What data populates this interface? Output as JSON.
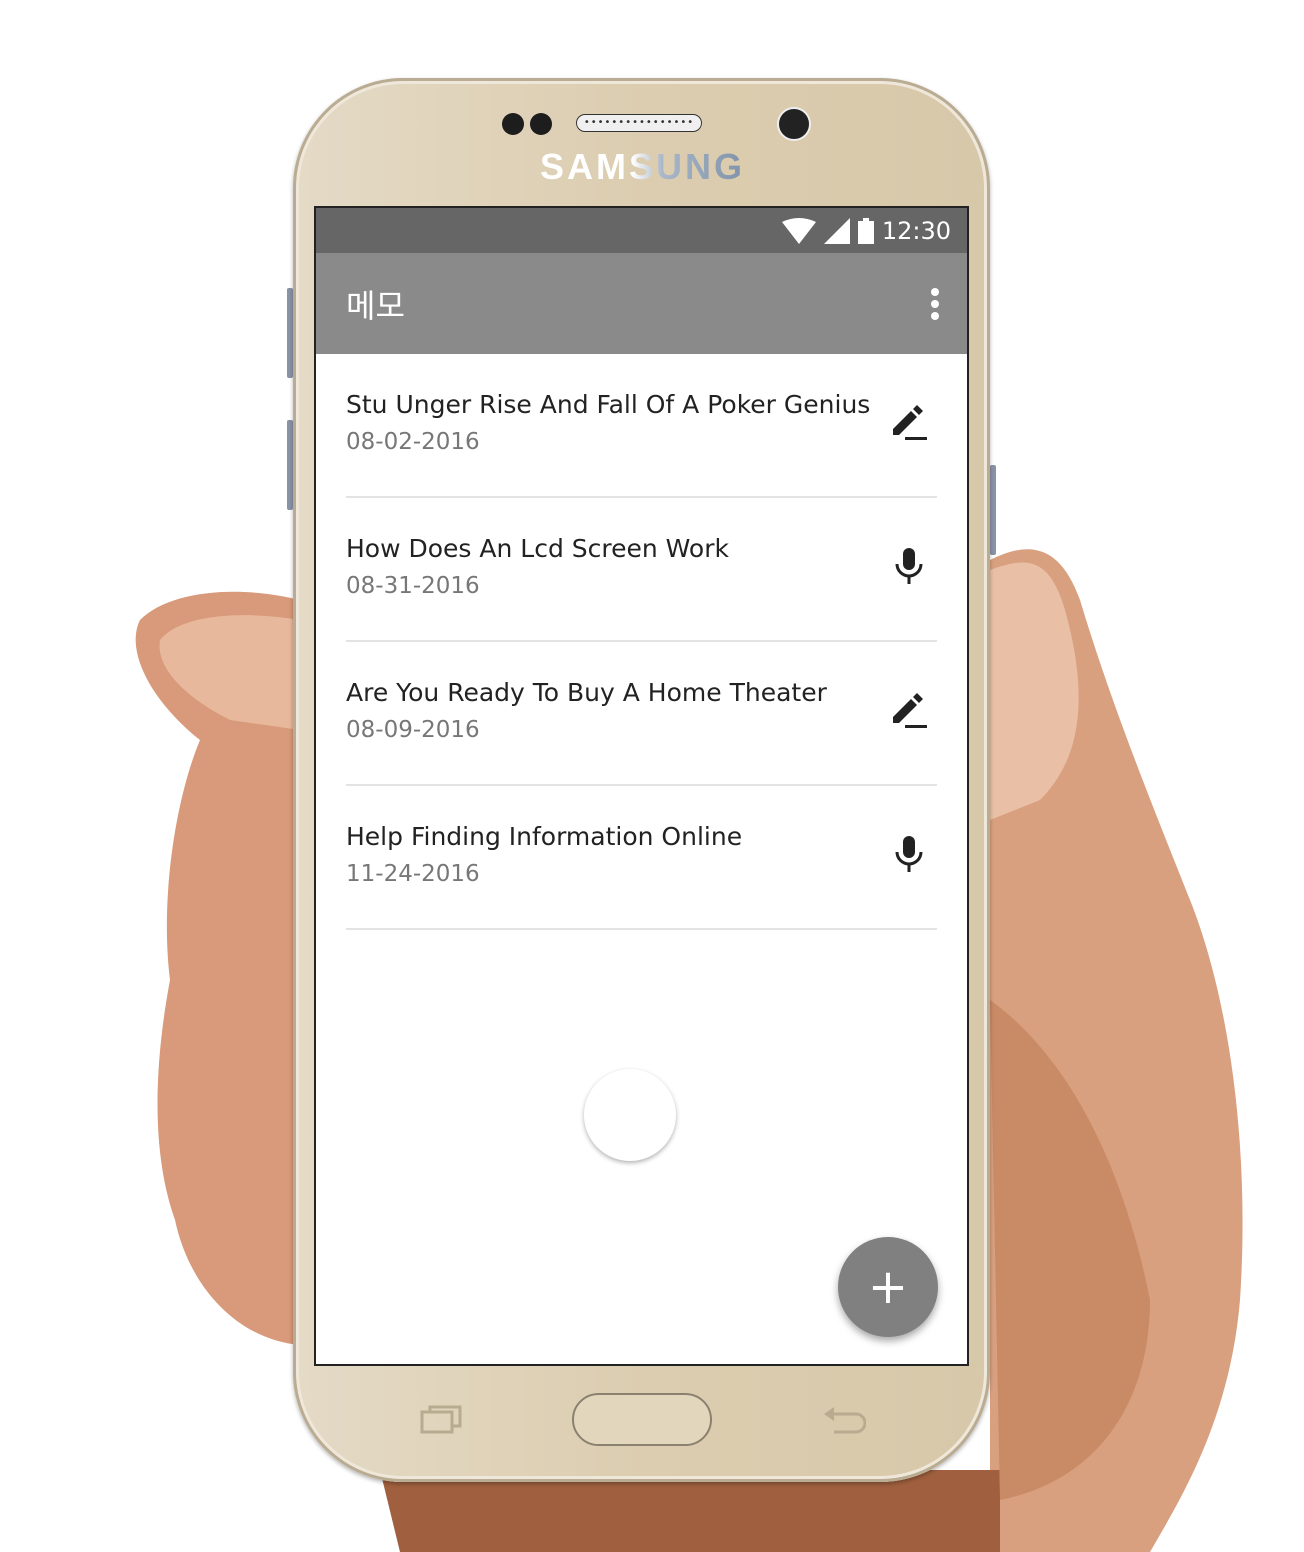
{
  "device": {
    "brand": "SAMSUNG",
    "speaker_grille": "••••••••••••••••"
  },
  "status_bar": {
    "time": "12:30",
    "icons": [
      "wifi-icon",
      "signal-icon",
      "battery-icon"
    ]
  },
  "app_bar": {
    "title": "메모",
    "menu_icon": "more-vert-icon"
  },
  "memos": [
    {
      "title": "Stu Unger Rise And Fall Of A Poker Genius",
      "date": "08-02-2016",
      "type": "pencil-icon"
    },
    {
      "title": "How Does An Lcd Screen Work",
      "date": "08-31-2016",
      "type": "mic-icon"
    },
    {
      "title": "Are You Ready To Buy A Home Theater",
      "date": "08-09-2016",
      "type": "pencil-icon"
    },
    {
      "title": "Help Finding Information Online",
      "date": "11-24-2016",
      "type": "mic-icon"
    }
  ],
  "fab": {
    "label": "+"
  },
  "colors": {
    "status": "#666666",
    "toolbar": "#8a8a8a",
    "fab": "#808080"
  }
}
